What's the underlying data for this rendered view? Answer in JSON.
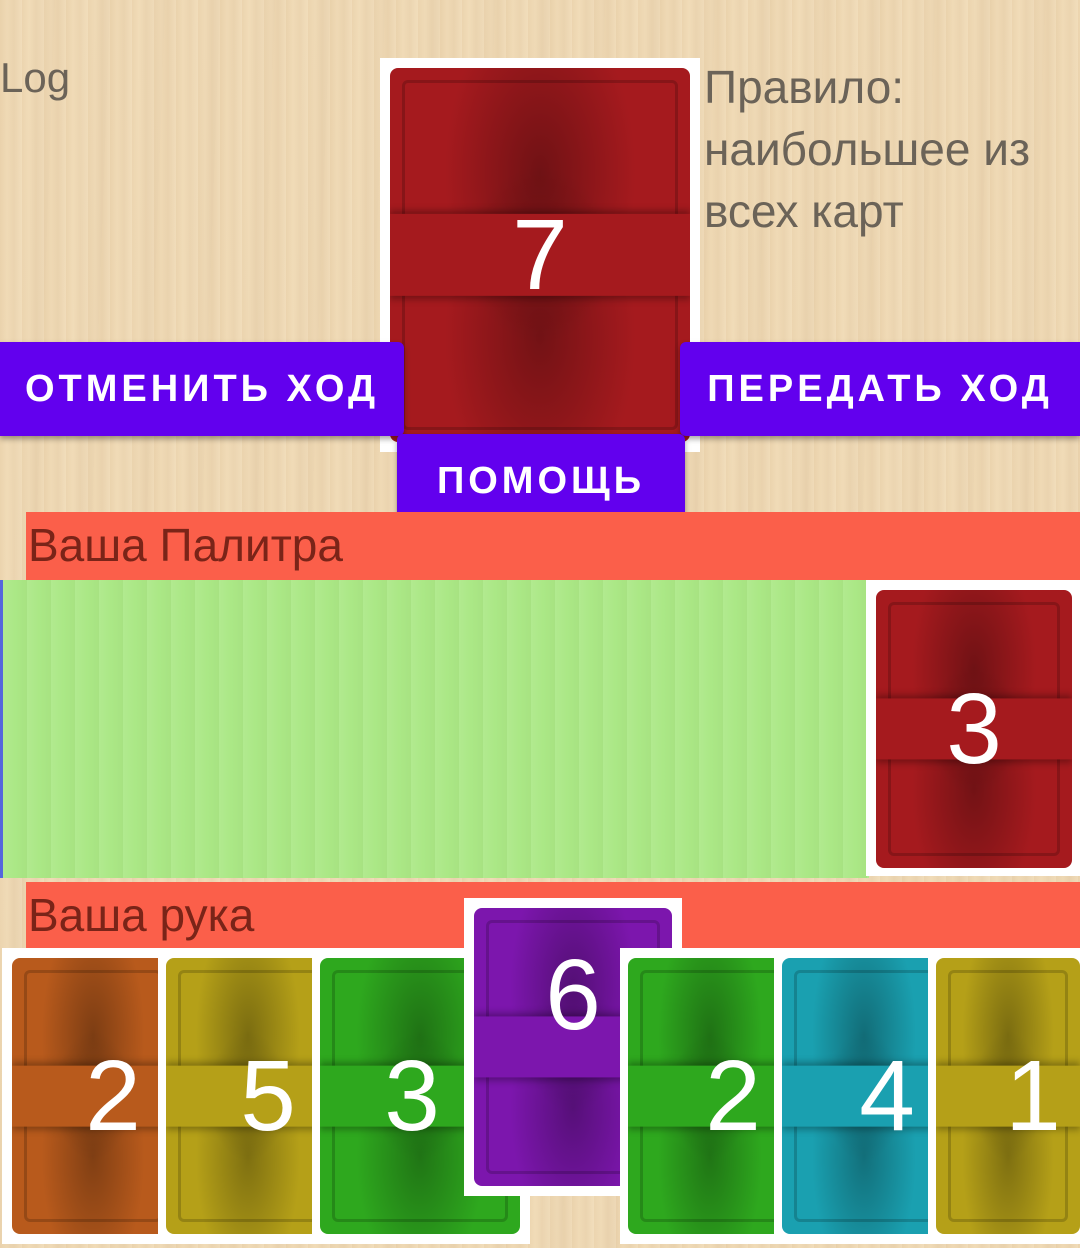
{
  "log": {
    "label": "Log"
  },
  "rule": {
    "lines": [
      "Правило:",
      "наибольшее из",
      "всех карт"
    ]
  },
  "center_card": {
    "value": "7",
    "color": "#a51a1e"
  },
  "buttons": {
    "undo": "ОТМЕНИТЬ ХОД",
    "pass": "ПЕРЕДАТЬ ХОД",
    "help": "ПОМОЩЬ",
    "color": "#6200ee"
  },
  "palette": {
    "label": "Ваша Палитра",
    "card": {
      "value": "3",
      "color": "#a51a1e"
    }
  },
  "hand": {
    "label": "Ваша рука",
    "cards": [
      {
        "value": "2",
        "color": "#b85a1c"
      },
      {
        "value": "5",
        "color": "#b5a018"
      },
      {
        "value": "3",
        "color": "#2ea81e"
      },
      {
        "value": "6",
        "color": "#7c16ad"
      },
      {
        "value": "2",
        "color": "#2ea81e"
      },
      {
        "value": "4",
        "color": "#1aa0b0"
      },
      {
        "value": "1",
        "color": "#b5a018"
      }
    ]
  }
}
